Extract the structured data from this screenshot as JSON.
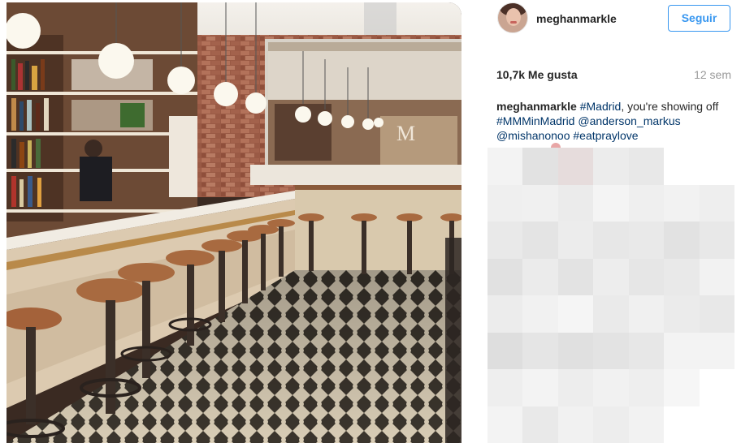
{
  "post": {
    "username": "meghanmarkle",
    "follow_label": "Seguir",
    "likes": "10,7k Me gusta",
    "time_ago": "12 sem",
    "caption": {
      "user": "meghanmarkle",
      "parts": [
        {
          "text": " ",
          "type": "plain"
        },
        {
          "text": "#Madrid",
          "type": "tag"
        },
        {
          "text": ", you're showing off ",
          "type": "plain"
        },
        {
          "text": "#MMMinMadrid",
          "type": "tag"
        },
        {
          "text": " ",
          "type": "plain"
        },
        {
          "text": "@anderson_markus",
          "type": "tag"
        },
        {
          "text": " ",
          "type": "plain"
        },
        {
          "text": "@mishanonoo",
          "type": "tag"
        },
        {
          "text": " ",
          "type": "plain"
        },
        {
          "text": "#eatpraylove",
          "type": "tag"
        }
      ]
    }
  },
  "colors": {
    "link": "#003569",
    "follow_blue": "#3897f0",
    "meta_gray": "#999999"
  },
  "mosaic": {
    "cols": 7,
    "rows": 8,
    "cells": [
      "#f3f3f3",
      "#e2e2e2",
      "#e6dcdc",
      "#ececec",
      "#e8e8e8",
      "#ffffff",
      "#ffffff",
      "#efefef",
      "#f0f0f0",
      "#ebebeb",
      "#f4f4f4",
      "#efefef",
      "#f2f2f2",
      "#eeeeee",
      "#e9e9e9",
      "#e4e4e4",
      "#ececec",
      "#e7e7e7",
      "#e9e9e9",
      "#e2e2e2",
      "#e8e8e8",
      "#e1e1e1",
      "#ebebeb",
      "#e3e3e3",
      "#ededed",
      "#e6e6e6",
      "#e9e9e9",
      "#f2f2f2",
      "#ececec",
      "#f1f1f1",
      "#f5f5f5",
      "#eaeaea",
      "#f0f0f0",
      "#ebebeb",
      "#e8e8e8",
      "#dedede",
      "#e5e5e5",
      "#e0e0e0",
      "#e3e3e3",
      "#e7e7e7",
      "#f3f3f3",
      "#f3f3f3",
      "#eeeeee",
      "#f3f3f3",
      "#ededed",
      "#f1f1f1",
      "#eeeeee",
      "#f6f6f6",
      "#ffffff",
      "#f3f3f3",
      "#e9e9e9",
      "#f1f1f1",
      "#ededed",
      "#f2f2f2",
      "#ffffff",
      "#ffffff"
    ]
  }
}
